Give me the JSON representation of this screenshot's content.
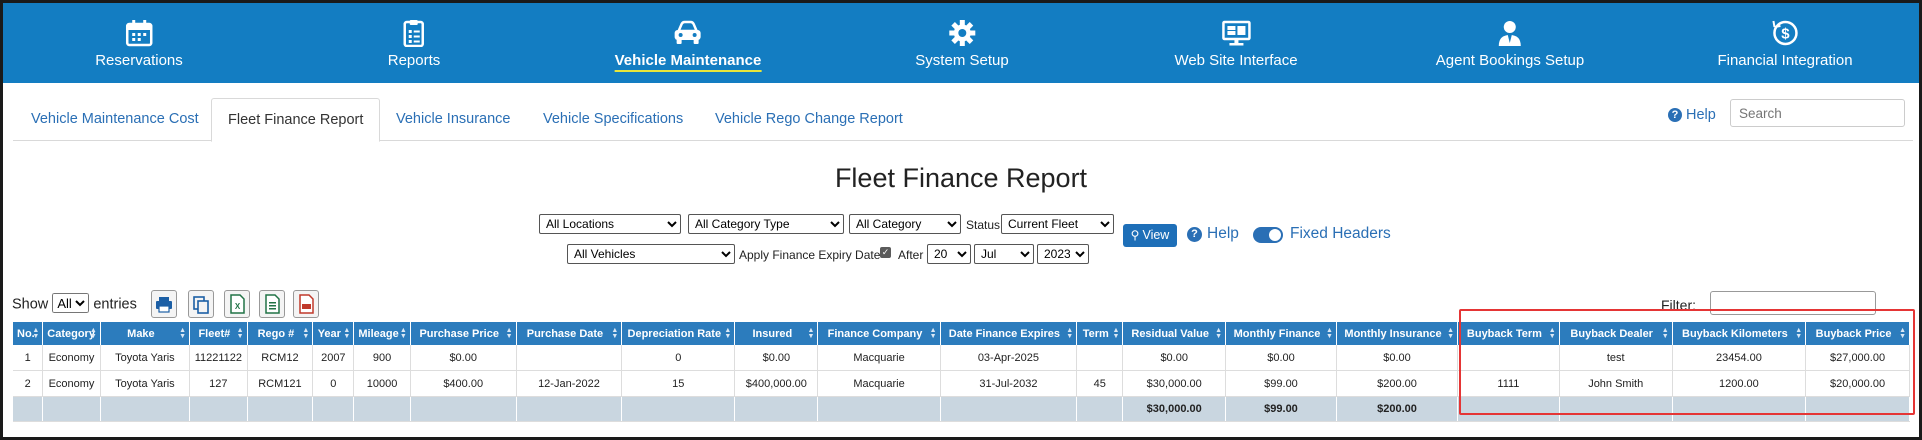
{
  "nav": [
    {
      "label": "Reservations",
      "icon": "calendar-icon"
    },
    {
      "label": "Reports",
      "icon": "clipboard-icon"
    },
    {
      "label": "Vehicle Maintenance",
      "icon": "car-icon",
      "active": true
    },
    {
      "label": "System Setup",
      "icon": "gear-icon"
    },
    {
      "label": "Web Site Interface",
      "icon": "monitor-icon"
    },
    {
      "label": "Agent Bookings Setup",
      "icon": "agent-icon"
    },
    {
      "label": "Financial Integration",
      "icon": "dollar-cycle-icon"
    }
  ],
  "tabs": [
    "Vehicle Maintenance Cost",
    "Fleet Finance Report",
    "Vehicle Insurance",
    "Vehicle Specifications",
    "Vehicle Rego Change Report"
  ],
  "active_tab": "Fleet Finance Report",
  "help_label": "Help",
  "search_placeholder": "Search",
  "page_title": "Fleet Finance Report",
  "filters": {
    "locations": "All Locations",
    "category_type": "All Category Type",
    "category": "All Category",
    "status_label": "Status",
    "status": "Current Fleet",
    "vehicles": "All Vehicles",
    "apply_expiry_label": "Apply Finance Expiry Date",
    "after_label": "After",
    "day": "20",
    "month": "Jul",
    "year": "2023",
    "view_label": "View",
    "help_label": "Help",
    "fixed_headers_label": "Fixed Headers"
  },
  "table_controls": {
    "show_label": "Show",
    "show_value": "All",
    "entries_label": "entries",
    "filter_label": "Filter:"
  },
  "columns": [
    "No.",
    "Category",
    "Make",
    "Fleet#",
    "Rego #",
    "Year",
    "Mileage",
    "Purchase Price",
    "Purchase Date",
    "Depreciation Rate",
    "Insured",
    "Finance Company",
    "Date Finance Expires",
    "Term",
    "Residual Value",
    "Monthly Finance",
    "Monthly Insurance",
    "Buyback Term",
    "Buyback Dealer",
    "Buyback Kilometers",
    "Buyback Price"
  ],
  "rows": [
    [
      "1",
      "Economy",
      "Toyota Yaris",
      "11221122",
      "RCM12",
      "2007",
      "900",
      "$0.00",
      "",
      "0",
      "$0.00",
      "Macquarie",
      "03-Apr-2025",
      "",
      "$0.00",
      "$0.00",
      "$0.00",
      "",
      "test",
      "23454.00",
      "$27,000.00"
    ],
    [
      "2",
      "Economy",
      "Toyota Yaris",
      "127",
      "RCM121",
      "0",
      "10000",
      "$400.00",
      "12-Jan-2022",
      "15",
      "$400,000.00",
      "Macquarie",
      "31-Jul-2032",
      "45",
      "$30,000.00",
      "$99.00",
      "$200.00",
      "1111",
      "John Smith",
      "1200.00",
      "$20,000.00"
    ]
  ],
  "totals": [
    "",
    "",
    "",
    "",
    "",
    "",
    "",
    "",
    "",
    "",
    "",
    "",
    "",
    "",
    "$30,000.00",
    "$99.00",
    "$200.00",
    "",
    "",
    "",
    ""
  ],
  "colors": {
    "nav_bg": "#137dc2",
    "header_bg": "#2c7cbd",
    "link": "#2a6fb5",
    "highlight": "#e53535"
  }
}
